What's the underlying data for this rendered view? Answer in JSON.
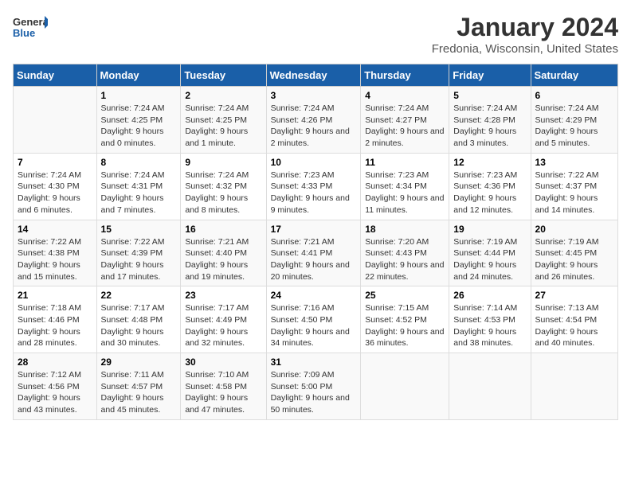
{
  "logo": {
    "text_general": "General",
    "text_blue": "Blue"
  },
  "title": "January 2024",
  "subtitle": "Fredonia, Wisconsin, United States",
  "days_of_week": [
    "Sunday",
    "Monday",
    "Tuesday",
    "Wednesday",
    "Thursday",
    "Friday",
    "Saturday"
  ],
  "weeks": [
    [
      {
        "day": "",
        "sunrise": "",
        "sunset": "",
        "daylight": ""
      },
      {
        "day": "1",
        "sunrise": "Sunrise: 7:24 AM",
        "sunset": "Sunset: 4:25 PM",
        "daylight": "Daylight: 9 hours and 0 minutes."
      },
      {
        "day": "2",
        "sunrise": "Sunrise: 7:24 AM",
        "sunset": "Sunset: 4:25 PM",
        "daylight": "Daylight: 9 hours and 1 minute."
      },
      {
        "day": "3",
        "sunrise": "Sunrise: 7:24 AM",
        "sunset": "Sunset: 4:26 PM",
        "daylight": "Daylight: 9 hours and 2 minutes."
      },
      {
        "day": "4",
        "sunrise": "Sunrise: 7:24 AM",
        "sunset": "Sunset: 4:27 PM",
        "daylight": "Daylight: 9 hours and 2 minutes."
      },
      {
        "day": "5",
        "sunrise": "Sunrise: 7:24 AM",
        "sunset": "Sunset: 4:28 PM",
        "daylight": "Daylight: 9 hours and 3 minutes."
      },
      {
        "day": "6",
        "sunrise": "Sunrise: 7:24 AM",
        "sunset": "Sunset: 4:29 PM",
        "daylight": "Daylight: 9 hours and 5 minutes."
      }
    ],
    [
      {
        "day": "7",
        "sunrise": "Sunrise: 7:24 AM",
        "sunset": "Sunset: 4:30 PM",
        "daylight": "Daylight: 9 hours and 6 minutes."
      },
      {
        "day": "8",
        "sunrise": "Sunrise: 7:24 AM",
        "sunset": "Sunset: 4:31 PM",
        "daylight": "Daylight: 9 hours and 7 minutes."
      },
      {
        "day": "9",
        "sunrise": "Sunrise: 7:24 AM",
        "sunset": "Sunset: 4:32 PM",
        "daylight": "Daylight: 9 hours and 8 minutes."
      },
      {
        "day": "10",
        "sunrise": "Sunrise: 7:23 AM",
        "sunset": "Sunset: 4:33 PM",
        "daylight": "Daylight: 9 hours and 9 minutes."
      },
      {
        "day": "11",
        "sunrise": "Sunrise: 7:23 AM",
        "sunset": "Sunset: 4:34 PM",
        "daylight": "Daylight: 9 hours and 11 minutes."
      },
      {
        "day": "12",
        "sunrise": "Sunrise: 7:23 AM",
        "sunset": "Sunset: 4:36 PM",
        "daylight": "Daylight: 9 hours and 12 minutes."
      },
      {
        "day": "13",
        "sunrise": "Sunrise: 7:22 AM",
        "sunset": "Sunset: 4:37 PM",
        "daylight": "Daylight: 9 hours and 14 minutes."
      }
    ],
    [
      {
        "day": "14",
        "sunrise": "Sunrise: 7:22 AM",
        "sunset": "Sunset: 4:38 PM",
        "daylight": "Daylight: 9 hours and 15 minutes."
      },
      {
        "day": "15",
        "sunrise": "Sunrise: 7:22 AM",
        "sunset": "Sunset: 4:39 PM",
        "daylight": "Daylight: 9 hours and 17 minutes."
      },
      {
        "day": "16",
        "sunrise": "Sunrise: 7:21 AM",
        "sunset": "Sunset: 4:40 PM",
        "daylight": "Daylight: 9 hours and 19 minutes."
      },
      {
        "day": "17",
        "sunrise": "Sunrise: 7:21 AM",
        "sunset": "Sunset: 4:41 PM",
        "daylight": "Daylight: 9 hours and 20 minutes."
      },
      {
        "day": "18",
        "sunrise": "Sunrise: 7:20 AM",
        "sunset": "Sunset: 4:43 PM",
        "daylight": "Daylight: 9 hours and 22 minutes."
      },
      {
        "day": "19",
        "sunrise": "Sunrise: 7:19 AM",
        "sunset": "Sunset: 4:44 PM",
        "daylight": "Daylight: 9 hours and 24 minutes."
      },
      {
        "day": "20",
        "sunrise": "Sunrise: 7:19 AM",
        "sunset": "Sunset: 4:45 PM",
        "daylight": "Daylight: 9 hours and 26 minutes."
      }
    ],
    [
      {
        "day": "21",
        "sunrise": "Sunrise: 7:18 AM",
        "sunset": "Sunset: 4:46 PM",
        "daylight": "Daylight: 9 hours and 28 minutes."
      },
      {
        "day": "22",
        "sunrise": "Sunrise: 7:17 AM",
        "sunset": "Sunset: 4:48 PM",
        "daylight": "Daylight: 9 hours and 30 minutes."
      },
      {
        "day": "23",
        "sunrise": "Sunrise: 7:17 AM",
        "sunset": "Sunset: 4:49 PM",
        "daylight": "Daylight: 9 hours and 32 minutes."
      },
      {
        "day": "24",
        "sunrise": "Sunrise: 7:16 AM",
        "sunset": "Sunset: 4:50 PM",
        "daylight": "Daylight: 9 hours and 34 minutes."
      },
      {
        "day": "25",
        "sunrise": "Sunrise: 7:15 AM",
        "sunset": "Sunset: 4:52 PM",
        "daylight": "Daylight: 9 hours and 36 minutes."
      },
      {
        "day": "26",
        "sunrise": "Sunrise: 7:14 AM",
        "sunset": "Sunset: 4:53 PM",
        "daylight": "Daylight: 9 hours and 38 minutes."
      },
      {
        "day": "27",
        "sunrise": "Sunrise: 7:13 AM",
        "sunset": "Sunset: 4:54 PM",
        "daylight": "Daylight: 9 hours and 40 minutes."
      }
    ],
    [
      {
        "day": "28",
        "sunrise": "Sunrise: 7:12 AM",
        "sunset": "Sunset: 4:56 PM",
        "daylight": "Daylight: 9 hours and 43 minutes."
      },
      {
        "day": "29",
        "sunrise": "Sunrise: 7:11 AM",
        "sunset": "Sunset: 4:57 PM",
        "daylight": "Daylight: 9 hours and 45 minutes."
      },
      {
        "day": "30",
        "sunrise": "Sunrise: 7:10 AM",
        "sunset": "Sunset: 4:58 PM",
        "daylight": "Daylight: 9 hours and 47 minutes."
      },
      {
        "day": "31",
        "sunrise": "Sunrise: 7:09 AM",
        "sunset": "Sunset: 5:00 PM",
        "daylight": "Daylight: 9 hours and 50 minutes."
      },
      {
        "day": "",
        "sunrise": "",
        "sunset": "",
        "daylight": ""
      },
      {
        "day": "",
        "sunrise": "",
        "sunset": "",
        "daylight": ""
      },
      {
        "day": "",
        "sunrise": "",
        "sunset": "",
        "daylight": ""
      }
    ]
  ]
}
